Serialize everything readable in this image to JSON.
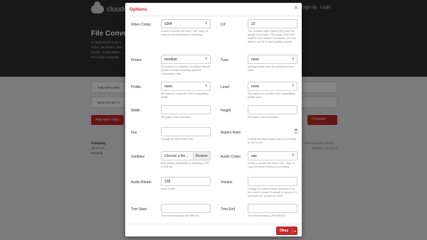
{
  "background": {
    "brand": "cloudc",
    "nav": [
      "Sign Up",
      "Login"
    ],
    "title": "File Conve",
    "description": "CloudConvert is an o... video, document, ebo... format. To get starte... from your computer.",
    "files": [
      "THE WITCHER",
      "WAS IST MIT C"
    ],
    "add_files_label": "Add more Files",
    "convert_label": "Convert",
    "footer": {
      "company_heading": "Company",
      "links": [
        "About Us",
        "Security"
      ],
      "right_text": "020 Lunaweb GmbH\n... Munich, Germany"
    }
  },
  "modal": {
    "title": "Options",
    "close_symbol": "×",
    "fields": {
      "video_codec": {
        "label": "Video Codec",
        "value": "x264",
        "help": "Codec to encode the video. Use \"copy\" to copy the stream without re-encoding."
      },
      "crf": {
        "label": "Crf",
        "value": "23",
        "help": "The Constant Rate Factor (CRF) sets the quality of the video. The range of the CRF scale is 0-51, where 0 is lossless, 23 is the default, and 51 is worst quality possible."
      },
      "preset": {
        "label": "Preset",
        "value": "medium",
        "help": "The preset is a collection of options that will provide a certain encoding speed to compression ratio."
      },
      "tune": {
        "label": "Tune",
        "value": "none",
        "help": "Settings based upon the specifics of your input."
      },
      "profile": {
        "label": "Profile",
        "value": "none",
        "help": "Set output to a specific H264 compatibility profile."
      },
      "level": {
        "label": "Level",
        "value": "none",
        "help": "Set output to a specific H264 compatibility profile level."
      },
      "width": {
        "label": "Width",
        "value": "",
        "help": "Set output video resolution."
      },
      "height": {
        "label": "Height",
        "value": "",
        "help": "Set output video resolution."
      },
      "fps": {
        "label": "Fps",
        "value": "",
        "help": "Change the video frame rate."
      },
      "aspect_ratio": {
        "label": "Aspect Ratio",
        "value": "",
        "help": "Change the video aspect ratio, for example to 16:9 or 4:3."
      },
      "subtitles": {
        "label": "Subtitles",
        "file_name": "Choose a file...",
        "browse": "Browse",
        "help": "Add subtitles (softsubs) by selecting a SRT or ASS file."
      },
      "audio_codec": {
        "label": "Audio Codec",
        "value": "aac",
        "help": "Codec to encode the audio. Use \"copy\" to copy the stream without re-encoding."
      },
      "audio_bitrate": {
        "label": "Audio Bitrate",
        "value": "128",
        "help": "Audio bitrate."
      },
      "volume": {
        "label": "Volume",
        "value": "",
        "help": "Change the audio volume, whereas 1.0 is the current volume. Example: a value of 2.0 increases the volume by 100%."
      },
      "trim_start": {
        "label": "Trim Start",
        "value": "",
        "help": "Trim start timestamp (HH:MM:SS)"
      },
      "trim_end": {
        "label": "Trim End",
        "value": "",
        "help": "Trim end timestamp (HH:MM:SS)"
      }
    },
    "okay_label": "Okay",
    "okay_dropdown_symbol": "▾",
    "select_caret": "⇕",
    "accent_color": "#c62828"
  }
}
